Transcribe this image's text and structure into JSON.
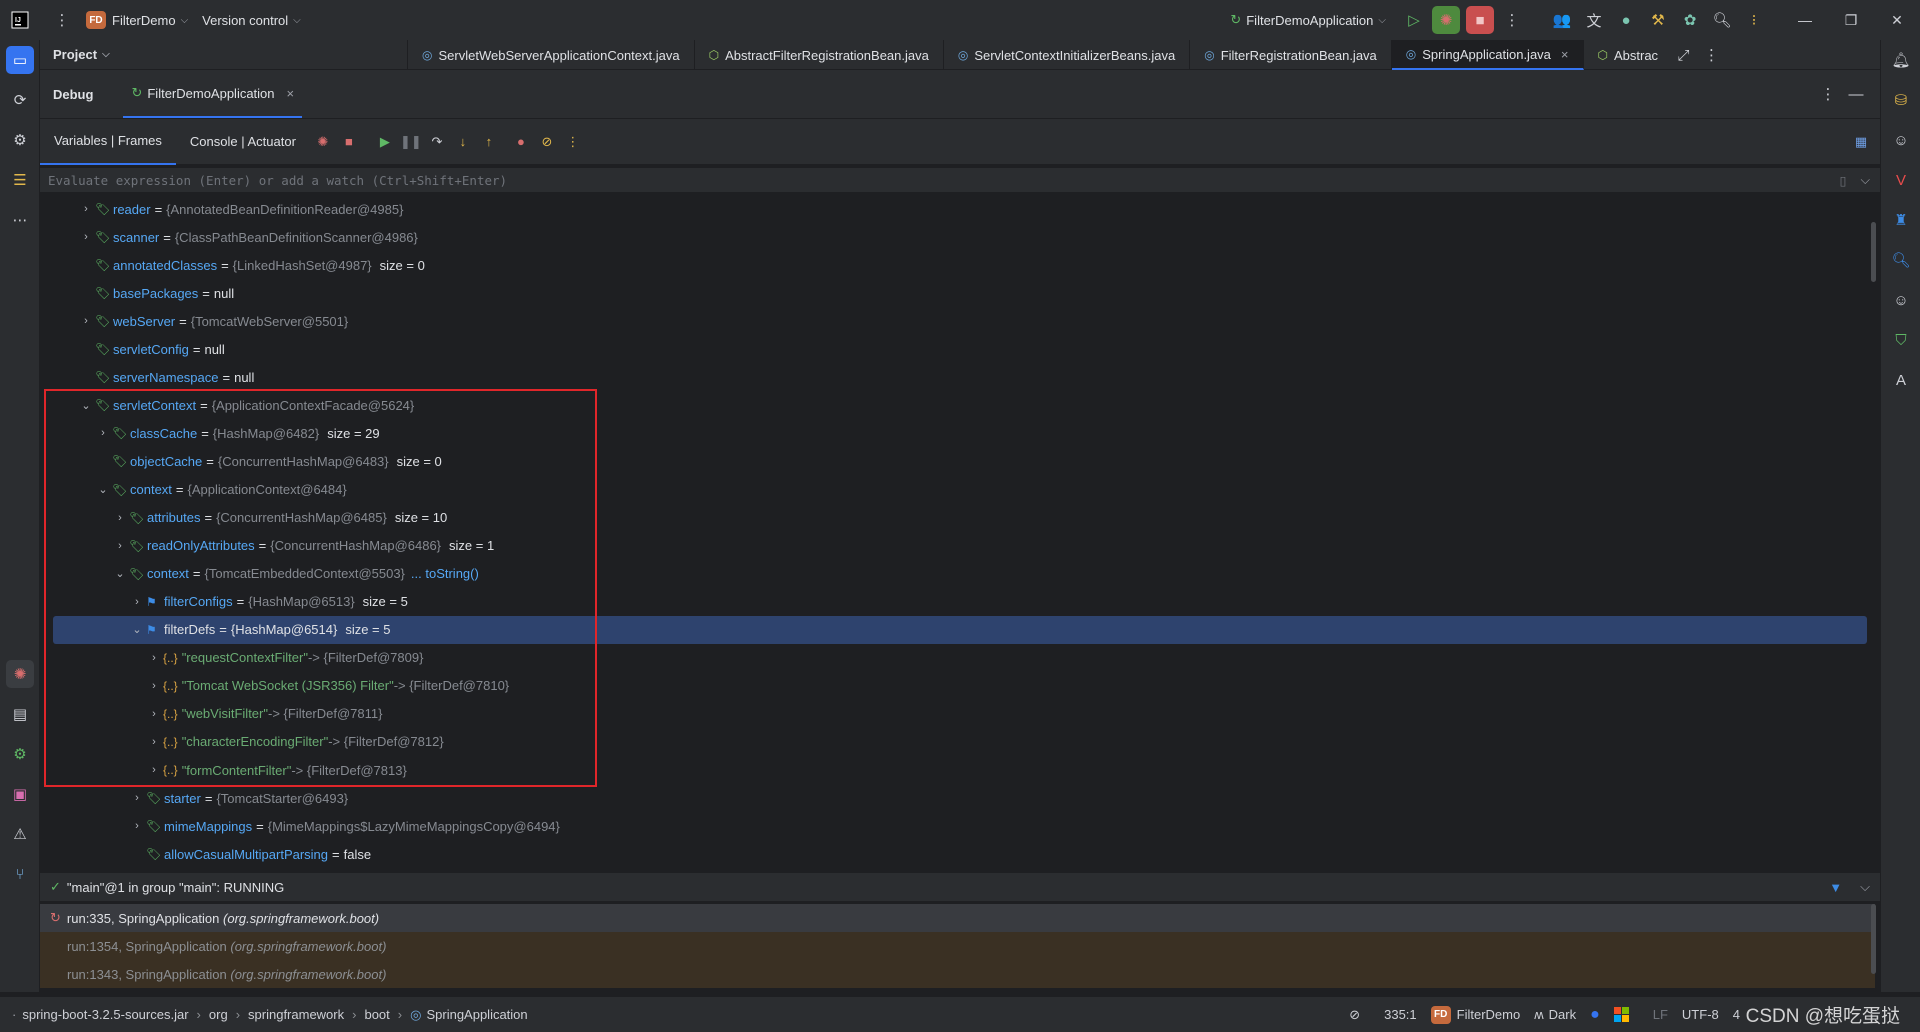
{
  "titlebar": {
    "project_badge": "FD",
    "project_name": "FilterDemo",
    "version_control": "Version control",
    "run_config": "FilterDemoApplication"
  },
  "editor_tabs": {
    "project_label": "Project",
    "tabs": [
      {
        "label": "ServletWebServerApplicationContext.java"
      },
      {
        "label": "AbstractFilterRegistrationBean.java"
      },
      {
        "label": "ServletContextInitializerBeans.java"
      },
      {
        "label": "FilterRegistrationBean.java"
      },
      {
        "label": "SpringApplication.java"
      },
      {
        "label": "Abstrac"
      }
    ],
    "close_glyph": "×"
  },
  "debug": {
    "title": "Debug",
    "session": "FilterDemoApplication",
    "tabs": [
      "Variables | Frames",
      "Console | Actuator"
    ],
    "eval_placeholder": "Evaluate expression (Enter) or add a watch (Ctrl+Shift+Enter)"
  },
  "variables": [
    {
      "name": "reader",
      "value": "{AnnotatedBeanDefinitionReader@4985}"
    },
    {
      "name": "scanner",
      "value": "{ClassPathBeanDefinitionScanner@4986}"
    },
    {
      "name": "annotatedClasses",
      "value": "{LinkedHashSet@4987}",
      "size": "size = 0"
    },
    {
      "name": "basePackages",
      "plain": "null"
    },
    {
      "name": "webServer",
      "value": "{TomcatWebServer@5501}"
    },
    {
      "name": "servletConfig",
      "plain": "null"
    },
    {
      "name": "serverNamespace",
      "plain": "null"
    },
    {
      "name": "servletContext",
      "value": "{ApplicationContextFacade@5624}"
    },
    {
      "name": "classCache",
      "value": "{HashMap@6482}",
      "size": "size = 29"
    },
    {
      "name": "objectCache",
      "value": "{ConcurrentHashMap@6483}",
      "size": "size = 0"
    },
    {
      "name": "context",
      "value": "{ApplicationContext@6484}"
    },
    {
      "name": "attributes",
      "value": "{ConcurrentHashMap@6485}",
      "size": "size = 10"
    },
    {
      "name": "readOnlyAttributes",
      "value": "{ConcurrentHashMap@6486}",
      "size": "size = 1"
    },
    {
      "name": "context",
      "value": "{TomcatEmbeddedContext@5503}",
      "link": "... toString()"
    },
    {
      "name": "filterConfigs",
      "value": "{HashMap@6513}",
      "size": "size = 5"
    },
    {
      "name": "filterDefs",
      "value": "{HashMap@6514}",
      "size": "size = 5"
    },
    {
      "key": "\"requestContextFilter\"",
      "value": "-> {FilterDef@7809}"
    },
    {
      "key": "\"Tomcat WebSocket (JSR356) Filter\"",
      "value": "-> {FilterDef@7810}"
    },
    {
      "key": "\"webVisitFilter\"",
      "value": "-> {FilterDef@7811}"
    },
    {
      "key": "\"characterEncodingFilter\"",
      "value": "-> {FilterDef@7812}"
    },
    {
      "key": "\"formContentFilter\"",
      "value": "-> {FilterDef@7813}"
    },
    {
      "name": "starter",
      "value": "{TomcatStarter@6493}"
    },
    {
      "name": "mimeMappings",
      "value": "{MimeMappings$LazyMimeMappingsCopy@6494}"
    },
    {
      "name": "allowCasualMultipartParsing",
      "plain": "false"
    }
  ],
  "map_icon": "{..}",
  "thread": "\"main\"@1 in group \"main\": RUNNING",
  "frames": [
    {
      "text": "run:335, SpringApplication",
      "pkg": "(org.springframework.boot)"
    },
    {
      "text": "run:1354, SpringApplication",
      "pkg": "(org.springframework.boot)"
    },
    {
      "text": "run:1343, SpringApplication",
      "pkg": "(org.springframework.boot)"
    }
  ],
  "statusbar": {
    "breadcrumbs": [
      "spring-boot-3.2.5-sources.jar",
      "org",
      "springframework",
      "boot",
      "SpringApplication"
    ],
    "position": "335:1",
    "project_badge": "FD",
    "project": "FilterDemo",
    "theme": "Dark",
    "line_sep": "LF",
    "encoding": "UTF-8",
    "indent": "4",
    "watermark": "CSDN @想吃蛋挞"
  },
  "colors": {
    "accent": "#3574f0",
    "highlight_box": "#e0262a",
    "selected_row": "#2e436e"
  }
}
